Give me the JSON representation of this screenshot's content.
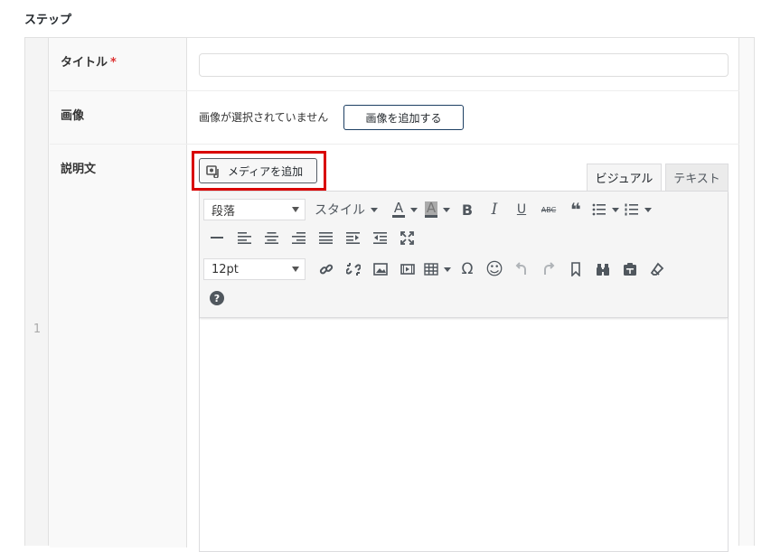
{
  "section": {
    "title": "ステップ"
  },
  "row": {
    "number": "1"
  },
  "fields": {
    "title": {
      "label": "タイトル",
      "required_mark": "*",
      "value": ""
    },
    "image": {
      "label": "画像",
      "no_image_text": "画像が選択されていません",
      "add_button": "画像を追加する"
    },
    "description": {
      "label": "説明文",
      "add_media_button": "メディアを追加"
    }
  },
  "editor": {
    "tabs": {
      "visual": "ビジュアル",
      "text": "テキスト"
    },
    "format_select": "段落",
    "style_dropdown": "スタイル",
    "text_color_glyph": "A",
    "bg_color_glyph": "A",
    "bold_glyph": "B",
    "italic_glyph": "I",
    "underline_glyph": "U",
    "strike_glyph": "ABC",
    "quote_glyph": "❝",
    "font_size_select": "12pt",
    "special_char_glyph": "Ω",
    "emoji_glyph": "☺",
    "help_glyph": "?",
    "content": ""
  },
  "icons": [
    "add-media-icon",
    "bold-icon",
    "italic-icon",
    "underline-icon",
    "strikethrough-icon",
    "blockquote-icon",
    "bullet-list-icon",
    "numbered-list-icon",
    "horizontal-rule-icon",
    "align-left-icon",
    "align-center-icon",
    "align-right-icon",
    "justify-icon",
    "indent-icon",
    "outdent-icon",
    "fullscreen-icon",
    "link-icon",
    "unlink-icon",
    "image-icon",
    "video-icon",
    "table-icon",
    "special-char-icon",
    "emoji-icon",
    "undo-icon",
    "redo-icon",
    "bookmark-icon",
    "find-icon",
    "paste-icon",
    "clear-format-icon",
    "help-icon"
  ],
  "colors": {
    "highlight": "#d90000",
    "required": "#dc3232",
    "button_border": "#1d3f63"
  }
}
